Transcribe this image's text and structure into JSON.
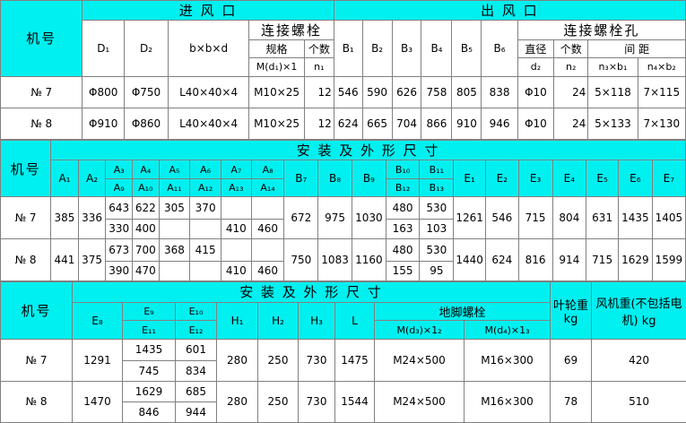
{
  "t1": {
    "machine": "机号",
    "inlet": "进 风 口",
    "outlet": "出 风 口",
    "bolt": "连接螺栓",
    "bolthole": "连接螺栓孔",
    "h": {
      "d1": "D₁",
      "d2": "D₂",
      "bbd": "b×b×d",
      "spec": "规格",
      "count": "个数",
      "m": "M(d₁)×1",
      "n1": "n₁",
      "b1": "B₁",
      "b2": "B₂",
      "b3": "B₃",
      "b4": "B₄",
      "b5": "B₅",
      "b6": "B₆",
      "dia": "直径",
      "cnt": "个数",
      "dist": "间  距",
      "d2s": "d₂",
      "n2": "n₂",
      "nb1": "n₃×b₁",
      "nb2": "n₄×b₂"
    },
    "rows": [
      {
        "no": "№ 7",
        "d1": "Φ800",
        "d2": "Φ750",
        "bbd": "L40×40×4",
        "m": "M10×25",
        "n1": "12",
        "b1": "546",
        "b2": "590",
        "b3": "626",
        "b4": "758",
        "b5": "805",
        "b6": "838",
        "dia": "Φ10",
        "n2": "24",
        "nb1": "5×118",
        "nb2": "7×115"
      },
      {
        "no": "№ 8",
        "d1": "Φ910",
        "d2": "Φ860",
        "bbd": "L40×40×4",
        "m": "M10×25",
        "n1": "12",
        "b1": "624",
        "b2": "665",
        "b3": "704",
        "b4": "866",
        "b5": "910",
        "b6": "946",
        "dia": "Φ10",
        "n2": "24",
        "nb1": "5×133",
        "nb2": "7×130"
      }
    ]
  },
  "t2": {
    "machine": "机号",
    "title": "安 装 及 外 形 尺 寸",
    "h": {
      "a1": "A₁",
      "a2": "A₂",
      "a3": "A₃",
      "a4": "A₄",
      "a5": "A₅",
      "a6": "A₆",
      "a7": "A₇",
      "a8": "A₈",
      "a9": "A₉",
      "a10": "A₁₀",
      "a11": "A₁₁",
      "a12": "A₁₂",
      "a13": "A₁₃",
      "a14": "A₁₄",
      "b7": "B₇",
      "b8": "B₈",
      "b9": "B₉",
      "b10": "B₁₀",
      "b11": "B₁₁",
      "b12": "B₁₂",
      "b13": "B₁₃",
      "e1": "E₁",
      "e2": "E₂",
      "e3": "E₃",
      "e4": "E₄",
      "e5": "E₅",
      "e6": "E₆",
      "e7": "E₇"
    },
    "rows": [
      {
        "no": "№ 7",
        "a1": "385",
        "a2": "336",
        "top": [
          "643",
          "622",
          "305",
          "370",
          "",
          ""
        ],
        "bot": [
          "330",
          "400",
          "",
          "",
          "410",
          "460"
        ],
        "b7": "672",
        "b8": "975",
        "b9": "1030",
        "b10": "480",
        "b11": "530",
        "b12": "163",
        "b13": "103",
        "e1": "1261",
        "e2": "546",
        "e3": "715",
        "e4": "804",
        "e5": "631",
        "e6": "1435",
        "e7": "1405"
      },
      {
        "no": "№ 8",
        "a1": "441",
        "a2": "375",
        "top": [
          "673",
          "700",
          "368",
          "415",
          "",
          ""
        ],
        "bot": [
          "390",
          "470",
          "",
          "",
          "410",
          "460"
        ],
        "b7": "750",
        "b8": "1083",
        "b9": "1160",
        "b10": "480",
        "b11": "530",
        "b12": "155",
        "b13": "95",
        "e1": "1440",
        "e2": "624",
        "e3": "816",
        "e4": "914",
        "e5": "715",
        "e6": "1629",
        "e7": "1599"
      }
    ]
  },
  "t3": {
    "machine": "机号",
    "title": "安 装 及 外 形 尺 寸",
    "impeller": "叶轮重 kg",
    "fanweight": "风机重(不包括电机) kg",
    "foot": "地脚螺栓",
    "h": {
      "e8": "E₈",
      "e9": "E₉",
      "e10": "E₁₀",
      "e11": "E₁₁",
      "e12": "E₁₂",
      "h1": "H₁",
      "h2": "H₂",
      "h3": "H₃",
      "l": "L",
      "m2": "M(d₃)×1₂",
      "m3": "M(d₄)×1₃"
    },
    "rows": [
      {
        "no": "№ 7",
        "e8": "1291",
        "e9": "1435",
        "e10": "601",
        "e11": "745",
        "e12": "834",
        "h1": "280",
        "h2": "250",
        "h3": "730",
        "l": "1475",
        "m2": "M24×500",
        "m3": "M16×300",
        "imp": "69",
        "fan": "420"
      },
      {
        "no": "№ 8",
        "e8": "1470",
        "e9": "1629",
        "e10": "685",
        "e11": "846",
        "e12": "944",
        "h1": "280",
        "h2": "250",
        "h3": "730",
        "l": "1544",
        "m2": "M24×500",
        "m3": "M16×300",
        "imp": "78",
        "fan": "510"
      }
    ]
  }
}
